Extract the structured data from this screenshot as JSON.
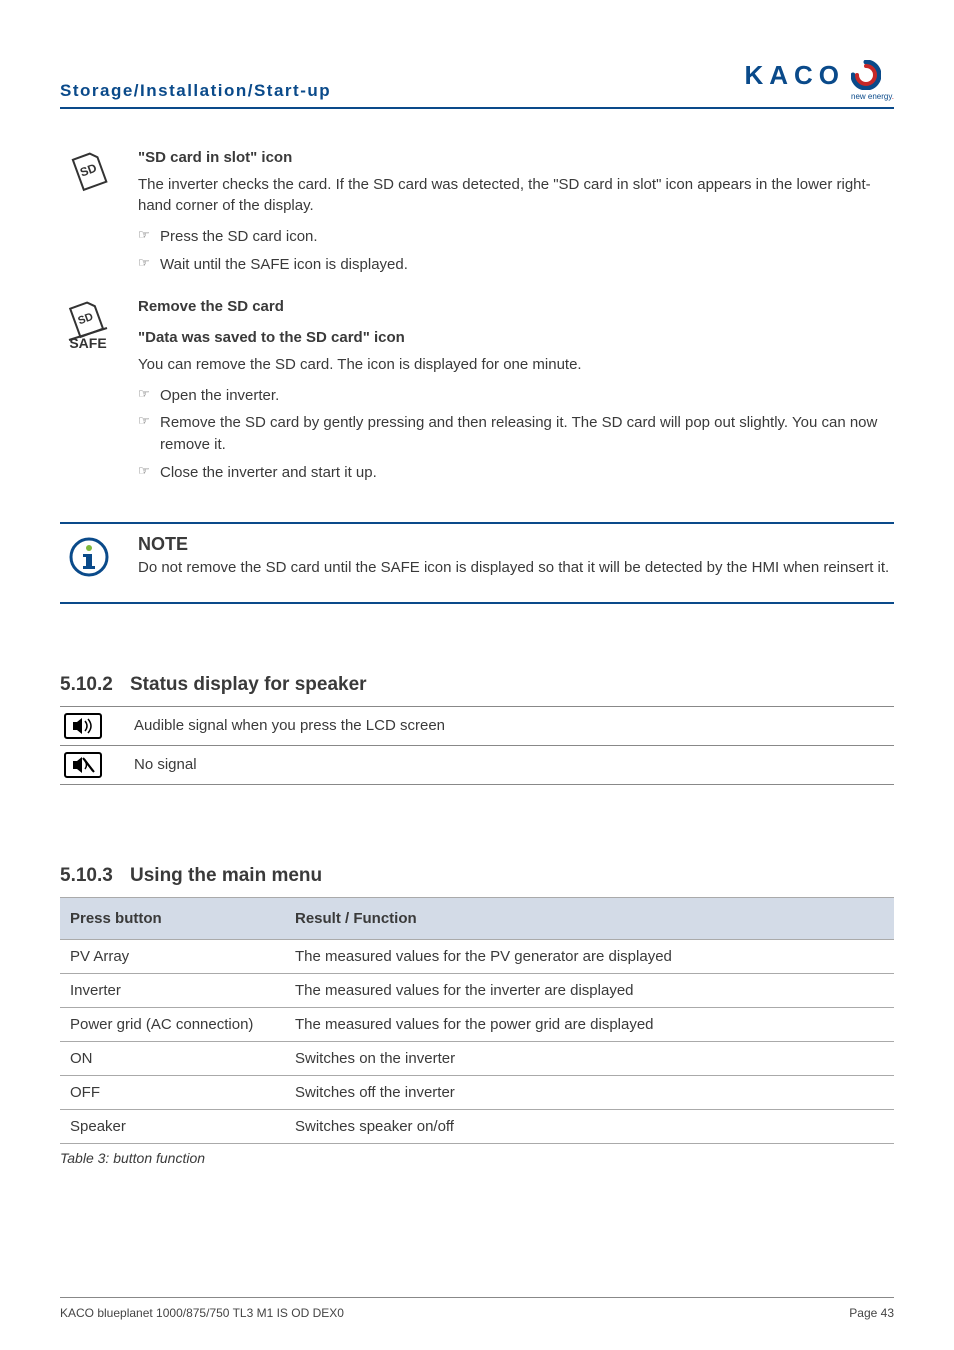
{
  "header": {
    "section_title": "Storage/Installation/Start-up",
    "logo_text": "KACO",
    "logo_sub_prefix": "new energy",
    "logo_sub_dot": "."
  },
  "sd_slot": {
    "title": "\"SD card in slot\" icon",
    "para": "The inverter checks the card. If the SD card was detected, the \"SD card in slot\" icon appears in the lower right-hand corner of the display.",
    "steps": [
      "Press the SD card icon.",
      "Wait until the SAFE icon is displayed."
    ]
  },
  "sd_remove": {
    "title": "Remove the SD card",
    "subtitle": "\"Data was saved to the SD card\" icon",
    "para": "You can remove the SD card. The icon is displayed for one minute.",
    "steps": [
      "Open the inverter.",
      "Remove the SD card by gently pressing and then releasing it. The SD card will pop out slightly. You can now remove it.",
      "Close the inverter and start it up."
    ],
    "safe_label": "SAFE"
  },
  "note": {
    "title": "NOTE",
    "body": "Do not remove the SD card until the SAFE icon is displayed so that it will be detected by the HMI when reinsert it."
  },
  "sec_speaker": {
    "number": "5.10.2",
    "title": "Status display for speaker",
    "rows": [
      {
        "label": "Audible signal when you press the LCD screen"
      },
      {
        "label": "No signal"
      }
    ]
  },
  "sec_menu": {
    "number": "5.10.3",
    "title": "Using the main menu",
    "header_button": "Press button",
    "header_result": "Result / Function",
    "rows": [
      {
        "button": "PV Array",
        "result": "The measured values for the PV generator are displayed"
      },
      {
        "button": "Inverter",
        "result": "The measured values for the inverter are displayed"
      },
      {
        "button": "Power grid (AC connection)",
        "result": "The measured values for the power grid are displayed"
      },
      {
        "button": "ON",
        "result": "Switches on the inverter"
      },
      {
        "button": "OFF",
        "result": "Switches off the inverter"
      },
      {
        "button": "Speaker",
        "result": "Switches speaker on/off"
      }
    ],
    "caption": "Table 3:  button function"
  },
  "footer": {
    "left": "KACO blueplanet 1000/875/750 TL3 M1 IS OD DEX0",
    "right": "Page 43"
  }
}
